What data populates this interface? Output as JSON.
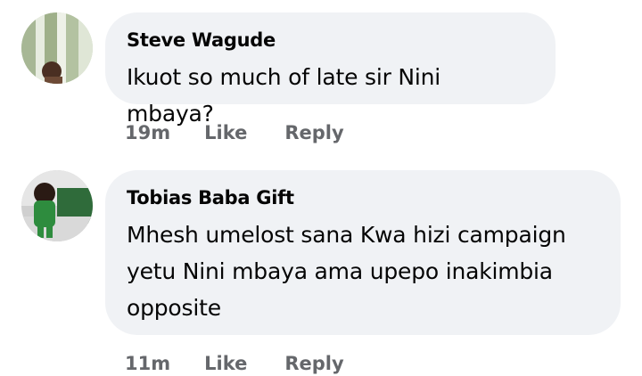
{
  "comments": [
    {
      "author": "Steve Wagude",
      "text": "Ikuot so much of late sir Nini mbaya?",
      "time": "19m",
      "like_label": "Like",
      "reply_label": "Reply"
    },
    {
      "author": "Tobias Baba Gift",
      "text": "Mhesh umelost sana Kwa hizi campaign yetu Nini mbaya ama upepo inakimbia opposite",
      "time": "11m",
      "like_label": "Like",
      "reply_label": "Reply"
    }
  ]
}
